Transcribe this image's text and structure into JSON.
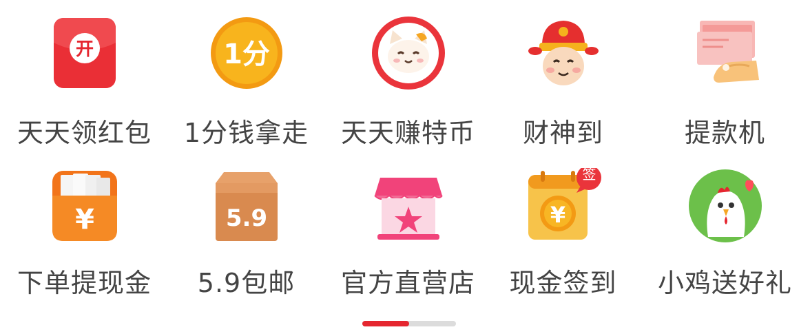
{
  "grid": {
    "items": [
      {
        "label": "天天领红包",
        "icon": "red-envelope-icon",
        "icon_text": "开"
      },
      {
        "label": "1分钱拿走",
        "icon": "one-cent-coin-icon",
        "icon_text": "1分"
      },
      {
        "label": "天天赚特币",
        "icon": "cat-face-icon"
      },
      {
        "label": "财神到",
        "icon": "god-of-wealth-icon"
      },
      {
        "label": "提款机",
        "icon": "cash-withdrawal-icon"
      },
      {
        "label": "下单提现金",
        "icon": "cash-envelope-icon",
        "icon_text": "¥"
      },
      {
        "label": "5.9包邮",
        "icon": "parcel-box-icon",
        "icon_text": "5.9"
      },
      {
        "label": "官方直营店",
        "icon": "storefront-icon"
      },
      {
        "label": "现金签到",
        "icon": "calendar-checkin-icon",
        "icon_text": "¥",
        "badge": "签"
      },
      {
        "label": "小鸡送好礼",
        "icon": "chick-icon"
      }
    ]
  },
  "pager": {
    "pages": 2,
    "current": 1,
    "progress": 0.5,
    "accent": "#e5262f",
    "track": "#dcdcdc"
  },
  "colors": {
    "red": "#e9343c",
    "orange": "#f6a21c",
    "pink": "#f1437a",
    "green": "#6cc04a",
    "label": "#444444"
  }
}
